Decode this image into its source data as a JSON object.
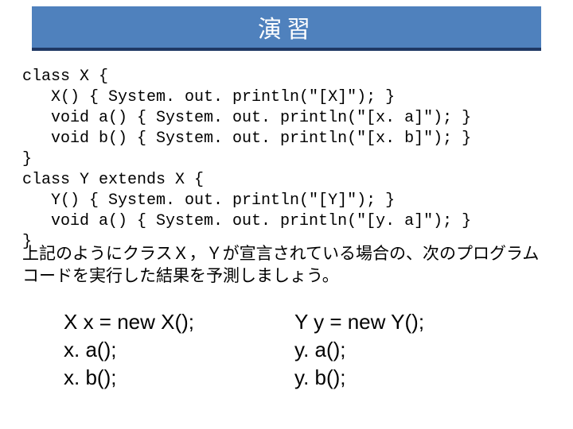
{
  "title": "演習",
  "code": "class X {\n   X() { System. out. println(\"[X]\"); }\n   void a() { System. out. println(\"[x. a]\"); }\n   void b() { System. out. println(\"[x. b]\"); }\n}\nclass Y extends X {\n   Y() { System. out. println(\"[Y]\"); }\n   void a() { System. out. println(\"[y. a]\"); }\n}",
  "instruction": "上記のようにクラスＸ，Ｙが宣言されている場合の、次のプログラムコードを実行した結果を予測しましょう。",
  "snippet_left": "X x = new X();\nx. a();\nx. b();",
  "snippet_right": "Y y = new Y();\ny. a();\ny. b();"
}
